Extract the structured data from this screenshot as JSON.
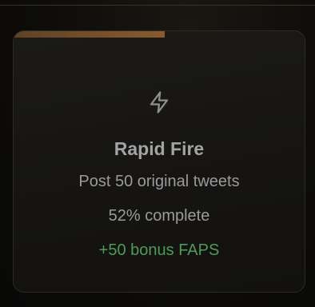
{
  "achievement": {
    "icon": "lightning-bolt-icon",
    "title": "Rapid Fire",
    "description": "Post 50 original tweets",
    "progress_text": "52% complete",
    "progress_fraction": 0.52,
    "reward": "+50 bonus FAPS"
  },
  "colors": {
    "progress": "#8a5a2e",
    "reward": "#4f9a57",
    "text": "#9a9a9a",
    "title": "#a3a3a3"
  }
}
